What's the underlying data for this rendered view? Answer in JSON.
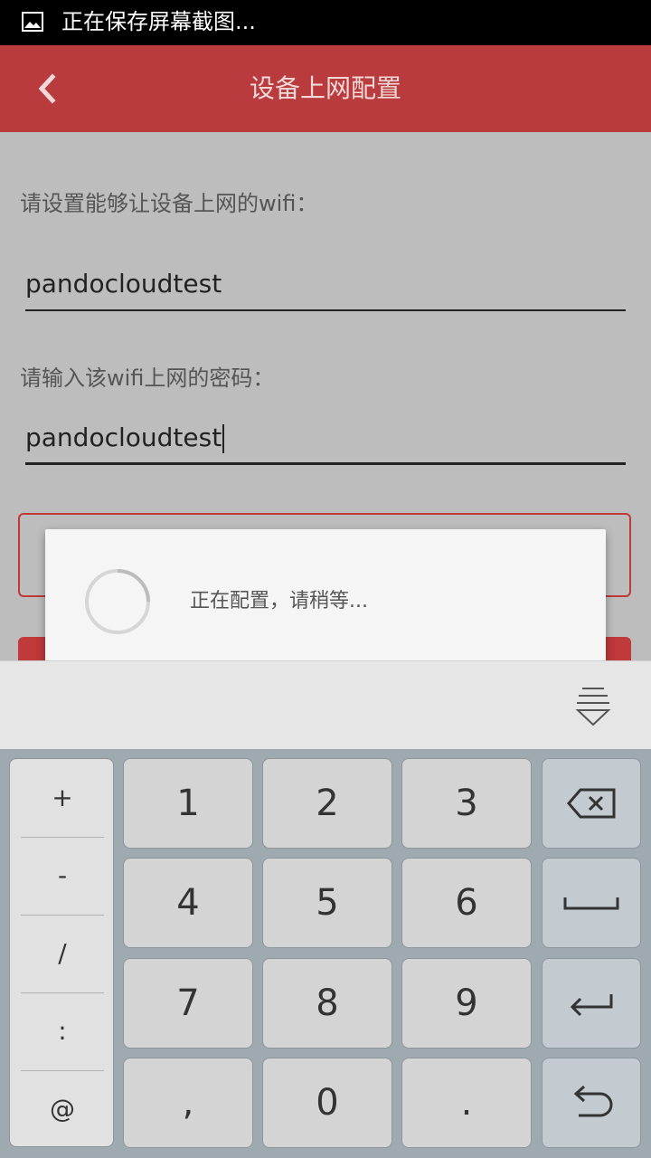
{
  "status_bar": {
    "text": "正在保存屏幕截图...",
    "icon": "image-icon"
  },
  "title_bar": {
    "title": "设备上网配置",
    "back_icon": "back-arrow-icon",
    "color": "#ba3b3d"
  },
  "form": {
    "wifi_label": "请设置能够让设备上网的wifi：",
    "wifi_value": "pandocloudtest",
    "password_label": "请输入该wifi上网的密码：",
    "password_value": "pandocloudtest"
  },
  "dialog": {
    "message": "正在配置，请稍等...",
    "icon": "loading-spinner-icon"
  },
  "keyboard": {
    "hide_icon": "hide-keyboard-icon",
    "symbols": [
      "+",
      "-",
      "/",
      ":",
      "@"
    ],
    "digits": [
      [
        "1",
        "2",
        "3"
      ],
      [
        "4",
        "5",
        "6"
      ],
      [
        "7",
        "8",
        "9"
      ],
      [
        ",",
        "0",
        "."
      ]
    ],
    "function_icons": [
      "backspace-icon",
      "space-icon",
      "enter-icon",
      "undo-icon"
    ]
  }
}
